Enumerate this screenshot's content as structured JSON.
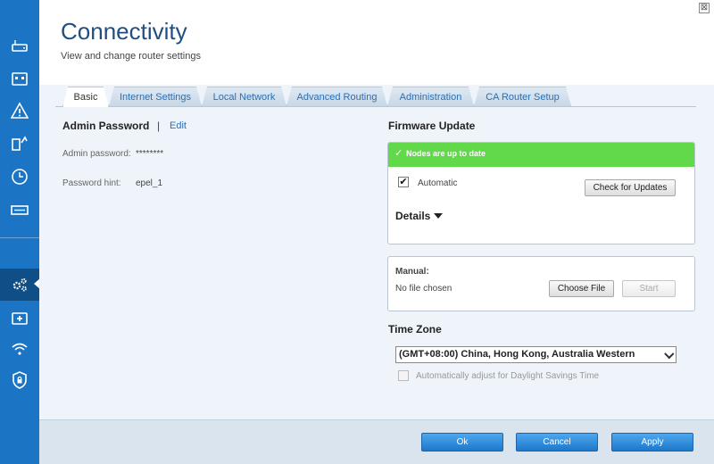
{
  "window": {
    "close_glyph": "⊠"
  },
  "sidebar": {
    "items": [
      {
        "icon": "router-icon"
      },
      {
        "icon": "devices-icon"
      },
      {
        "icon": "warning-icon"
      },
      {
        "icon": "priority-icon"
      },
      {
        "icon": "clock-icon"
      },
      {
        "icon": "speed-icon"
      },
      {
        "icon": "gear-icon",
        "active": true
      },
      {
        "icon": "troubleshoot-icon"
      },
      {
        "icon": "wifi-icon"
      },
      {
        "icon": "security-icon"
      }
    ],
    "color": "#1b74c4",
    "active_color": "#0f4e86"
  },
  "header": {
    "title": "Connectivity",
    "subtitle": "View and change router settings"
  },
  "tabs": [
    {
      "label": "Basic",
      "active": true
    },
    {
      "label": "Internet Settings"
    },
    {
      "label": "Local Network"
    },
    {
      "label": "Advanced Routing"
    },
    {
      "label": "Administration"
    },
    {
      "label": "CA Router Setup"
    }
  ],
  "admin": {
    "heading": "Admin Password",
    "separator": "|",
    "edit_label": "Edit",
    "password_label": "Admin password:",
    "password_value": "********",
    "hint_label": "Password hint:",
    "hint_value": "epel_1"
  },
  "firmware": {
    "heading": "Firmware Update",
    "status": "Nodes are up to date",
    "status_color": "#62d94a",
    "automatic_label": "Automatic",
    "automatic_checked": true,
    "check_button": "Check for Updates",
    "details_label": "Details",
    "manual_label": "Manual:",
    "file_status": "No file chosen",
    "choose_button": "Choose File",
    "start_button": "Start"
  },
  "timezone": {
    "heading": "Time Zone",
    "selected": "(GMT+08:00) China, Hong Kong, Australia Western",
    "dst_label": "Automatically adjust for Daylight Savings Time",
    "dst_checked": false
  },
  "footer": {
    "ok": "Ok",
    "cancel": "Cancel",
    "apply": "Apply"
  },
  "colors": {
    "accent": "#1b74c4",
    "title": "#1f4f82",
    "link": "#2a6fb5"
  }
}
